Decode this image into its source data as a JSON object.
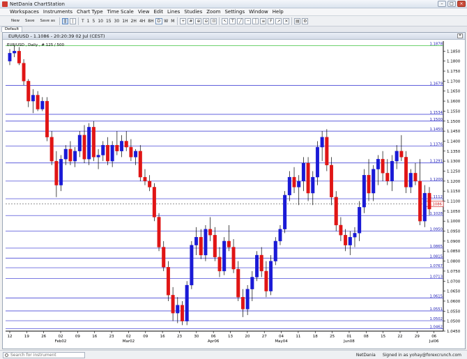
{
  "window": {
    "title": "NetDania ChartStation"
  },
  "menu": [
    "Workspaces",
    "Instruments",
    "Chart Type",
    "Time Scale",
    "View",
    "Edit",
    "Lines",
    "Studies",
    "Zoom",
    "Settings",
    "Window",
    "Help"
  ],
  "toolbar": {
    "new_label": "New",
    "save_label": "Save",
    "saveas_label": "Save as",
    "periods": [
      "T",
      "1",
      "5",
      "10",
      "15",
      "30",
      "1H",
      "2H",
      "4H",
      "8H",
      "D",
      "W",
      "M"
    ],
    "active_period": "D"
  },
  "tabs": {
    "default_label": "Default"
  },
  "chart_header": "EUR/USD - 1.1086 - 20:20:39  02 Jul (CEST)",
  "chart_label": "EUR/USD , Daily , # 125 / 500",
  "status": {
    "search_placeholder": "Search for instrument",
    "brand": "NetDania",
    "signed_in": "Signed in as yohay@forexcrunch.com"
  },
  "colors": {
    "up": "#1a1ad6",
    "down": "#e01515",
    "hline": "#2b2bd0",
    "topline": "#18b818"
  },
  "chart_data": {
    "type": "candlestick",
    "ylim": [
      1.045,
      1.19
    ],
    "y_ticks": [
      1.045,
      1.05,
      1.055,
      1.06,
      1.065,
      1.07,
      1.075,
      1.08,
      1.085,
      1.09,
      1.095,
      1.1,
      1.105,
      1.11,
      1.115,
      1.12,
      1.125,
      1.13,
      1.135,
      1.14,
      1.145,
      1.15,
      1.155,
      1.16,
      1.165,
      1.17,
      1.175,
      1.18,
      1.185
    ],
    "x_ticks": [
      "12",
      "19",
      "26",
      "02",
      "09",
      "16",
      "23",
      "02",
      "09",
      "16",
      "23",
      "30",
      "06",
      "13",
      "20",
      "27",
      "04",
      "11",
      "18",
      "25",
      "01",
      "08",
      "15",
      "22",
      "29",
      "06"
    ],
    "month_labels": [
      [
        "Feb02",
        3
      ],
      [
        "Mar02",
        7
      ],
      [
        "Apr06",
        12
      ],
      [
        "May04",
        16
      ],
      [
        "Jun08",
        20
      ],
      [
        "Jul06",
        25
      ]
    ],
    "levels": [
      {
        "value": 1.1878,
        "label": "1.1878",
        "color": "#18b818"
      },
      {
        "value": 1.1679,
        "label": "1.1679"
      },
      {
        "value": 1.1534,
        "label": "1.1534"
      },
      {
        "value": 1.15,
        "label": "1.1500"
      },
      {
        "value": 1.145,
        "label": "1.1450"
      },
      {
        "value": 1.1376,
        "label": "1.1376"
      },
      {
        "value": 1.1291,
        "label": "1.1291"
      },
      {
        "value": 1.12,
        "label": "1.1200"
      },
      {
        "value": 1.1112,
        "label": "1.1112"
      },
      {
        "value": 1.1028,
        "label": "1.1028"
      },
      {
        "value": 1.095,
        "label": "1.0950"
      },
      {
        "value": 1.0865,
        "label": "1.0865"
      },
      {
        "value": 1.0815,
        "label": "1.0815"
      },
      {
        "value": 1.0767,
        "label": "1.0767"
      },
      {
        "value": 1.0713,
        "label": "1.0713"
      },
      {
        "value": 1.0615,
        "label": "1.0615"
      },
      {
        "value": 1.0551,
        "label": "1.0551"
      },
      {
        "value": 1.0502,
        "label": "1.0502"
      },
      {
        "value": 1.0462,
        "label": "1.0462"
      }
    ],
    "current": {
      "value": 1.1086,
      "label": "1.1086"
    },
    "candles": [
      [
        1.18,
        1.186,
        1.178,
        1.184
      ],
      [
        1.184,
        1.188,
        1.182,
        1.185
      ],
      [
        1.185,
        1.187,
        1.178,
        1.179
      ],
      [
        1.179,
        1.181,
        1.168,
        1.17
      ],
      [
        1.17,
        1.171,
        1.157,
        1.16
      ],
      [
        1.16,
        1.166,
        1.154,
        1.163
      ],
      [
        1.163,
        1.165,
        1.155,
        1.156
      ],
      [
        1.156,
        1.162,
        1.155,
        1.16
      ],
      [
        1.16,
        1.162,
        1.14,
        1.142
      ],
      [
        1.142,
        1.145,
        1.128,
        1.13
      ],
      [
        1.13,
        1.135,
        1.112,
        1.118
      ],
      [
        1.118,
        1.133,
        1.115,
        1.131
      ],
      [
        1.131,
        1.138,
        1.128,
        1.136
      ],
      [
        1.136,
        1.14,
        1.128,
        1.13
      ],
      [
        1.13,
        1.137,
        1.127,
        1.135
      ],
      [
        1.135,
        1.145,
        1.132,
        1.143
      ],
      [
        1.143,
        1.148,
        1.129,
        1.131
      ],
      [
        1.131,
        1.149,
        1.128,
        1.147
      ],
      [
        1.147,
        1.15,
        1.13,
        1.132
      ],
      [
        1.132,
        1.136,
        1.126,
        1.133
      ],
      [
        1.133,
        1.14,
        1.13,
        1.138
      ],
      [
        1.138,
        1.142,
        1.128,
        1.13
      ],
      [
        1.13,
        1.14,
        1.127,
        1.138
      ],
      [
        1.138,
        1.145,
        1.133,
        1.135
      ],
      [
        1.135,
        1.143,
        1.132,
        1.14
      ],
      [
        1.14,
        1.145,
        1.135,
        1.137
      ],
      [
        1.137,
        1.141,
        1.13,
        1.132
      ],
      [
        1.132,
        1.136,
        1.128,
        1.135
      ],
      [
        1.135,
        1.138,
        1.12,
        1.122
      ],
      [
        1.122,
        1.126,
        1.118,
        1.12
      ],
      [
        1.12,
        1.123,
        1.115,
        1.117
      ],
      [
        1.117,
        1.119,
        1.1,
        1.102
      ],
      [
        1.102,
        1.104,
        1.085,
        1.087
      ],
      [
        1.087,
        1.09,
        1.075,
        1.077
      ],
      [
        1.077,
        1.08,
        1.06,
        1.063
      ],
      [
        1.063,
        1.067,
        1.05,
        1.054
      ],
      [
        1.054,
        1.062,
        1.049,
        1.058
      ],
      [
        1.058,
        1.06,
        1.048,
        1.05
      ],
      [
        1.05,
        1.07,
        1.048,
        1.068
      ],
      [
        1.068,
        1.09,
        1.066,
        1.088
      ],
      [
        1.088,
        1.097,
        1.083,
        1.092
      ],
      [
        1.092,
        1.096,
        1.081,
        1.083
      ],
      [
        1.083,
        1.098,
        1.08,
        1.096
      ],
      [
        1.096,
        1.102,
        1.09,
        1.093
      ],
      [
        1.093,
        1.097,
        1.08,
        1.082
      ],
      [
        1.082,
        1.087,
        1.072,
        1.075
      ],
      [
        1.075,
        1.092,
        1.073,
        1.09
      ],
      [
        1.09,
        1.098,
        1.085,
        1.087
      ],
      [
        1.087,
        1.091,
        1.074,
        1.076
      ],
      [
        1.076,
        1.08,
        1.06,
        1.062
      ],
      [
        1.062,
        1.066,
        1.052,
        1.056
      ],
      [
        1.056,
        1.068,
        1.053,
        1.066
      ],
      [
        1.066,
        1.075,
        1.06,
        1.072
      ],
      [
        1.072,
        1.085,
        1.07,
        1.083
      ],
      [
        1.083,
        1.087,
        1.072,
        1.075
      ],
      [
        1.075,
        1.08,
        1.062,
        1.065
      ],
      [
        1.065,
        1.083,
        1.063,
        1.08
      ],
      [
        1.08,
        1.092,
        1.078,
        1.09
      ],
      [
        1.09,
        1.098,
        1.088,
        1.096
      ],
      [
        1.096,
        1.115,
        1.094,
        1.113
      ],
      [
        1.113,
        1.125,
        1.11,
        1.122
      ],
      [
        1.122,
        1.127,
        1.114,
        1.117
      ],
      [
        1.117,
        1.123,
        1.108,
        1.12
      ],
      [
        1.12,
        1.132,
        1.115,
        1.129
      ],
      [
        1.129,
        1.132,
        1.11,
        1.114
      ],
      [
        1.114,
        1.125,
        1.108,
        1.122
      ],
      [
        1.122,
        1.14,
        1.118,
        1.137
      ],
      [
        1.137,
        1.145,
        1.13,
        1.142
      ],
      [
        1.142,
        1.146,
        1.125,
        1.128
      ],
      [
        1.128,
        1.132,
        1.108,
        1.112
      ],
      [
        1.112,
        1.115,
        1.095,
        1.098
      ],
      [
        1.098,
        1.102,
        1.09,
        1.093
      ],
      [
        1.093,
        1.096,
        1.085,
        1.088
      ],
      [
        1.088,
        1.095,
        1.083,
        1.092
      ],
      [
        1.092,
        1.097,
        1.087,
        1.094
      ],
      [
        1.094,
        1.11,
        1.09,
        1.107
      ],
      [
        1.107,
        1.126,
        1.104,
        1.123
      ],
      [
        1.123,
        1.131,
        1.11,
        1.114
      ],
      [
        1.114,
        1.128,
        1.11,
        1.126
      ],
      [
        1.126,
        1.133,
        1.118,
        1.131
      ],
      [
        1.131,
        1.135,
        1.12,
        1.124
      ],
      [
        1.124,
        1.131,
        1.118,
        1.12
      ],
      [
        1.12,
        1.133,
        1.115,
        1.13
      ],
      [
        1.13,
        1.138,
        1.126,
        1.135
      ],
      [
        1.135,
        1.143,
        1.13,
        1.132
      ],
      [
        1.132,
        1.135,
        1.114,
        1.117
      ],
      [
        1.117,
        1.126,
        1.114,
        1.124
      ],
      [
        1.124,
        1.129,
        1.118,
        1.12
      ],
      [
        1.12,
        1.131,
        1.098,
        1.1
      ],
      [
        1.1,
        1.118,
        1.097,
        1.114
      ],
      [
        1.114,
        1.117,
        1.103,
        1.106
      ]
    ]
  }
}
